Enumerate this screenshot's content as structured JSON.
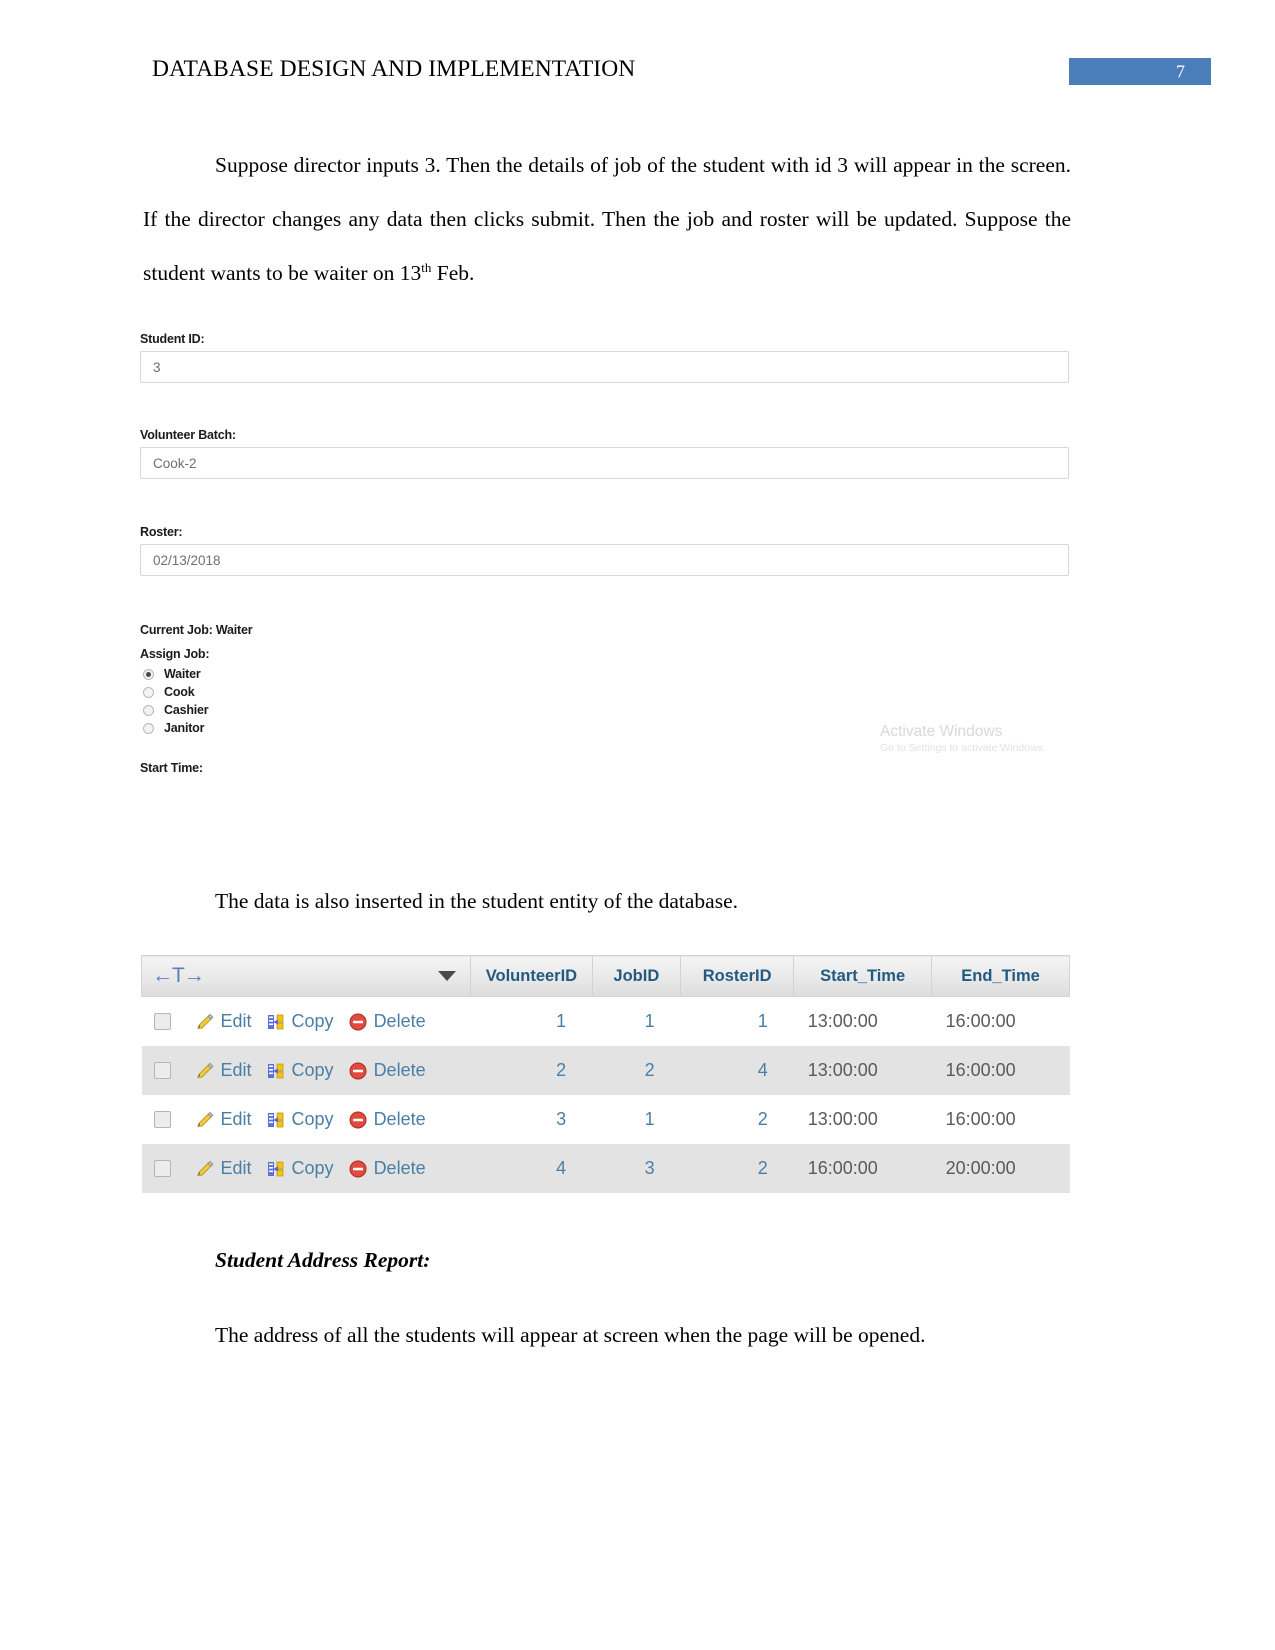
{
  "header": {
    "title": "DATABASE DESIGN AND IMPLEMENTATION",
    "page_number": "7",
    "badge_color": "#4a7ebb"
  },
  "paragraphs": {
    "intro_part1": "Suppose director inputs 3. Then the details of job of the student with id 3 will appear in the screen. If the director changes any data then clicks submit. Then the job and roster will be updated. Suppose the student wants to be waiter on 13",
    "intro_sup": "th",
    "intro_part2": " Feb.",
    "inserted_note": "The data is also inserted in the student entity of the database.",
    "report_heading": "Student Address Report:",
    "address_note": "The address of all the students will appear at screen when the page will be opened."
  },
  "form": {
    "student_id": {
      "label": "Student ID:",
      "value": "3"
    },
    "volunteer_batch": {
      "label": "Volunteer Batch:",
      "value": "Cook-2"
    },
    "roster": {
      "label": "Roster:",
      "value": "02/13/2018"
    },
    "current_job": "Current Job: Waiter",
    "assign_job_label": "Assign Job:",
    "job_options": [
      {
        "label": "Waiter",
        "selected": true
      },
      {
        "label": "Cook",
        "selected": false
      },
      {
        "label": "Cashier",
        "selected": false
      },
      {
        "label": "Janitor",
        "selected": false
      }
    ],
    "start_time_label": "Start Time:"
  },
  "watermark": {
    "title": "Activate Windows",
    "subtitle": "Go to Settings to activate Windows."
  },
  "table": {
    "actions_header": "←T→",
    "columns": [
      "VolunteerID",
      "JobID",
      "RosterID",
      "Start_Time",
      "End_Time"
    ],
    "action_labels": {
      "edit": "Edit",
      "copy": "Copy",
      "delete": "Delete"
    },
    "rows": [
      {
        "VolunteerID": "1",
        "JobID": "1",
        "RosterID": "1",
        "Start_Time": "13:00:00",
        "End_Time": "16:00:00"
      },
      {
        "VolunteerID": "2",
        "JobID": "2",
        "RosterID": "4",
        "Start_Time": "13:00:00",
        "End_Time": "16:00:00"
      },
      {
        "VolunteerID": "3",
        "JobID": "1",
        "RosterID": "2",
        "Start_Time": "13:00:00",
        "End_Time": "16:00:00"
      },
      {
        "VolunteerID": "4",
        "JobID": "3",
        "RosterID": "2",
        "Start_Time": "16:00:00",
        "End_Time": "20:00:00"
      }
    ]
  }
}
